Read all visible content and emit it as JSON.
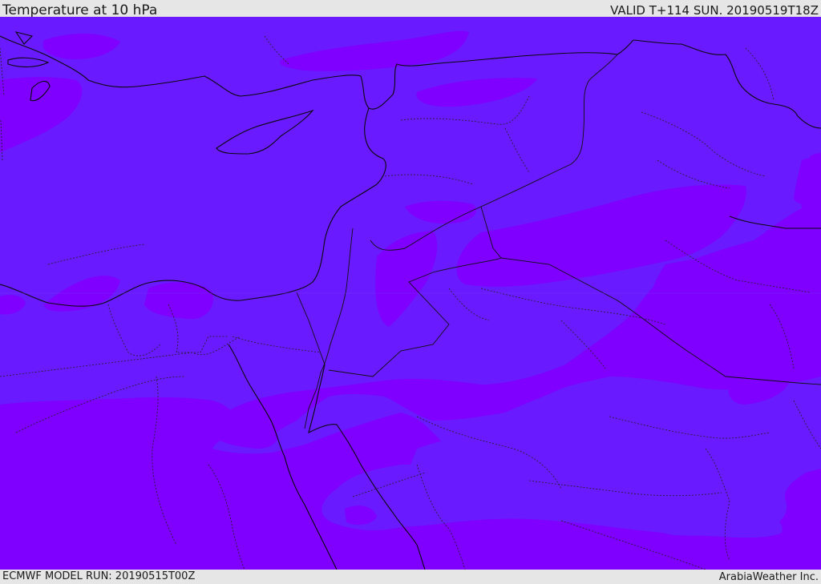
{
  "header": {
    "title": "Temperature at 10 hPa",
    "valid": "VALID T+114 SUN. 20190519T18Z"
  },
  "footer": {
    "model_run": "ECMWF MODEL RUN: 20190515T00Z",
    "credit": "ArabiaWeather Inc."
  },
  "map": {
    "field": "temperature",
    "level": "10 hPa",
    "colors": {
      "warmer_band": "#6a1aff",
      "colder_band": "#7f00ff",
      "coastline": "#0a0a0a",
      "borders": "#1a1a1a"
    }
  }
}
